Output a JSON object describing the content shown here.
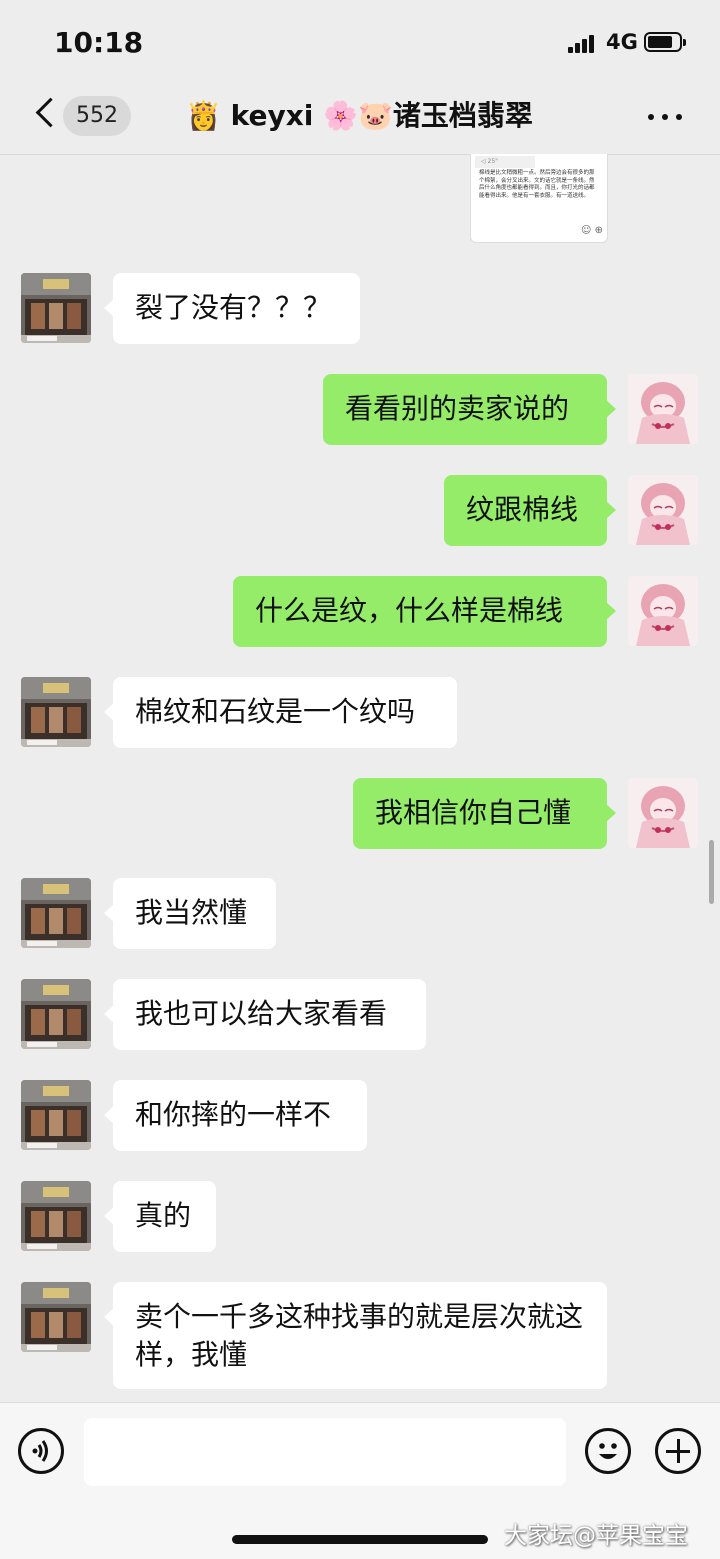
{
  "status_bar": {
    "time": "10:18",
    "network": "4G"
  },
  "nav": {
    "unread_count": "552",
    "title": "👸 keyxi 🌸🐷诸玉档翡翠"
  },
  "forwarded_screenshot": {
    "tag": "◁ 25\"",
    "text": "棉线是比文稍微粗一点。然后旁边会有很多的那个棉絮，会分叉出来。文的话它就是一条线。然后什么角度也都能看得到。而且，你打光的话都能看得出来。他是有一套衣服。有一道送线。"
  },
  "messages": [
    {
      "side": "left",
      "text": "裂了没有？？？"
    },
    {
      "side": "right",
      "text": "看看别的卖家说的"
    },
    {
      "side": "right",
      "text": "纹跟棉线"
    },
    {
      "side": "right",
      "text": "什么是纹，什么样是棉线"
    },
    {
      "side": "left",
      "text": "棉纹和石纹是一个纹吗"
    },
    {
      "side": "right",
      "text": "我相信你自己懂"
    },
    {
      "side": "left",
      "text": "我当然懂"
    },
    {
      "side": "left",
      "text": "我也可以给大家看看"
    },
    {
      "side": "left",
      "text": "和你摔的一样不"
    },
    {
      "side": "left",
      "text": "真的"
    },
    {
      "side": "left",
      "text": "卖个一千多这种找事的就是层次就这样，我懂"
    }
  ],
  "input": {
    "placeholder": ""
  },
  "watermark": "大家坛@苹果宝宝",
  "colors": {
    "sent_bubble": "#95ec69",
    "received_bubble": "#ffffff",
    "background": "#ededed"
  }
}
